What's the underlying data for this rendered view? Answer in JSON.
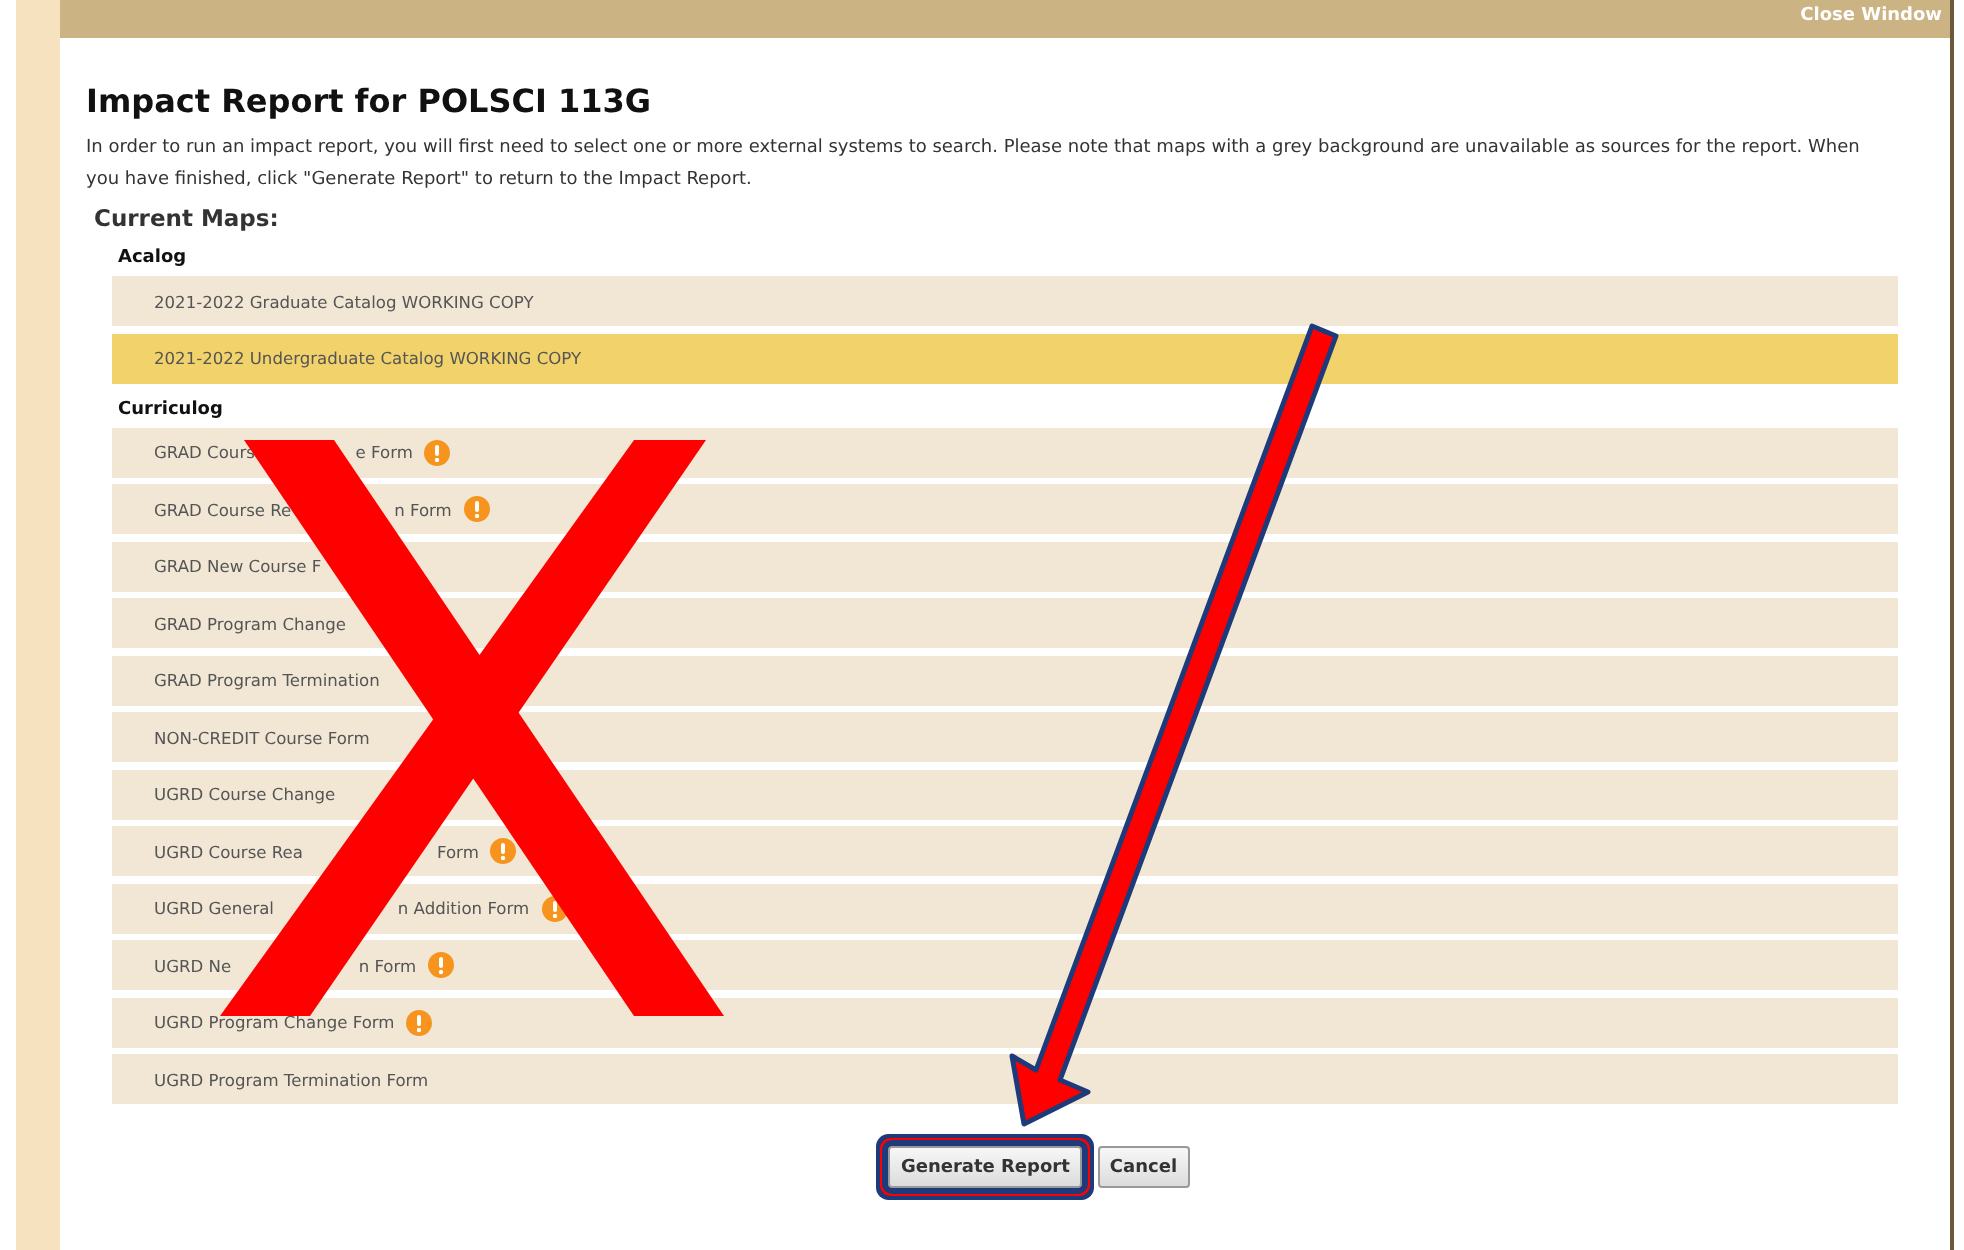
{
  "window": {
    "close_link": "Close Window"
  },
  "title": "Impact Report for POLSCI 113G",
  "instructions": "In order to run an impact report, you will first need to select one or more external systems to search. Please note that maps with a grey background are unavailable as sources for the report. When you have finished, click \"Generate Report\" to return to the Impact Report.",
  "current_maps_label": "Current Maps:",
  "groups": [
    {
      "name": "Acalog",
      "maps": [
        {
          "label": "2021-2022 Graduate Catalog WORKING COPY",
          "selected": false,
          "warning": false
        },
        {
          "label": "2021-2022 Undergraduate Catalog WORKING COPY",
          "selected": true,
          "warning": false
        }
      ]
    },
    {
      "name": "Curriculog",
      "maps": [
        {
          "label": "GRAD Cours",
          "label_tail": "e Form",
          "selected": false,
          "warning": true
        },
        {
          "label": "GRAD Course Re",
          "label_tail": "n Form",
          "selected": false,
          "warning": true
        },
        {
          "label": "GRAD New Course F",
          "selected": false,
          "warning": false
        },
        {
          "label": "GRAD Program Change",
          "selected": false,
          "warning": false
        },
        {
          "label": "GRAD Program Termination",
          "selected": false,
          "warning": false
        },
        {
          "label": "NON-CREDIT Course Form",
          "selected": false,
          "warning": false
        },
        {
          "label": "UGRD Course Change",
          "selected": false,
          "warning": false
        },
        {
          "label": "UGRD Course Rea",
          "label_tail": "Form",
          "selected": false,
          "warning": true
        },
        {
          "label": "UGRD General",
          "label_tail": "n Addition Form",
          "selected": false,
          "warning": true
        },
        {
          "label": "UGRD Ne",
          "label_tail": "n Form",
          "selected": false,
          "warning": true
        },
        {
          "label": "UGRD Program Change Form",
          "selected": false,
          "warning": true
        },
        {
          "label": "UGRD Program Termination Form",
          "selected": false,
          "warning": false
        }
      ]
    }
  ],
  "buttons": [
    {
      "label": "Generate Report",
      "highlighted": true
    },
    {
      "label": "Cancel",
      "highlighted": false
    }
  ]
}
